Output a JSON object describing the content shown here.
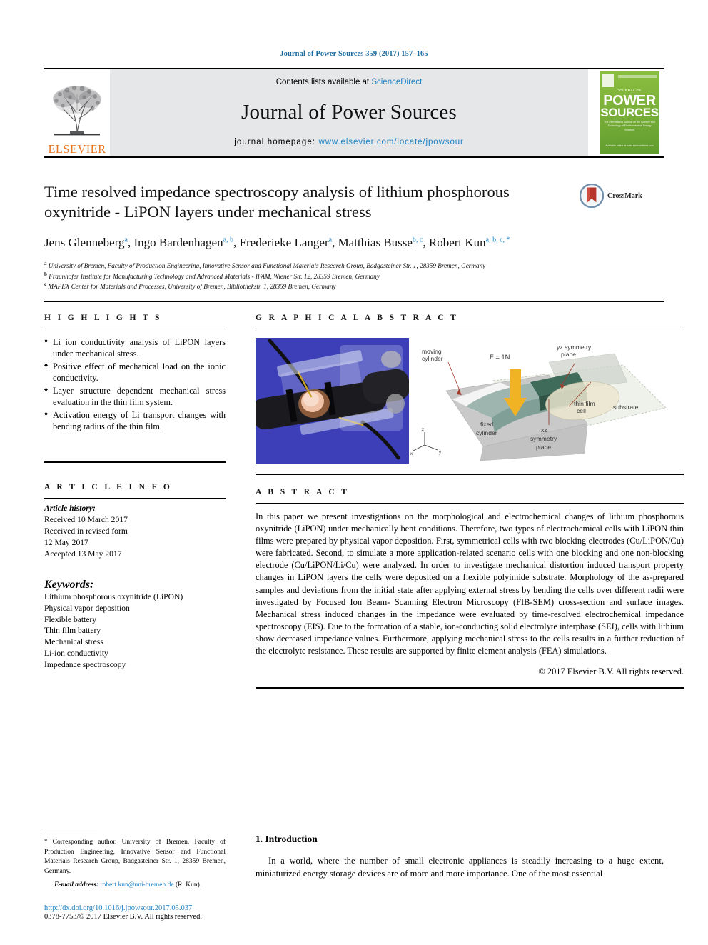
{
  "running_head": "Journal of Power Sources 359 (2017) 157–165",
  "masthead": {
    "contents_prefix": "Contents lists available at ",
    "sciencedirect": "ScienceDirect",
    "journal_title": "Journal of Power Sources",
    "homepage_label": "journal homepage:",
    "homepage_url": "www.elsevier.com/locate/jpowsour",
    "publisher": "ELSEVIER",
    "cover": {
      "kicker": "JOURNAL OF",
      "word1": "POWER",
      "word2": "SOURCES",
      "subtitle": "The International Journal on the Science and Technology of Electrochemical Energy Systems",
      "footer": "Available online at\nwww.sciencedirect.com"
    }
  },
  "article": {
    "title": "Time resolved impedance spectroscopy analysis of lithium phosphorous oxynitride - LiPON layers under mechanical stress",
    "crossmark_label": "CrossMark",
    "authors": [
      {
        "name": "Jens Glenneberg",
        "sup": "a",
        "sep": ", "
      },
      {
        "name": "Ingo Bardenhagen",
        "sup": "a, b",
        "sep": ", "
      },
      {
        "name": "Frederieke Langer",
        "sup": "a",
        "sep": ", "
      },
      {
        "name": "Matthias Busse",
        "sup": "b, c",
        "sep": ", "
      },
      {
        "name": "Robert Kun",
        "sup": "a, b, c, *",
        "sep": ""
      }
    ],
    "affiliations": [
      {
        "marker": "a",
        "text": "University of Bremen, Faculty of Production Engineering, Innovative Sensor and Functional Materials Research Group, Badgasteiner Str. 1, 28359 Bremen, Germany"
      },
      {
        "marker": "b",
        "text": "Fraunhofer Institute for Manufacturing Technology and Advanced Materials - IFAM, Wiener Str. 12, 28359 Bremen, Germany"
      },
      {
        "marker": "c",
        "text": "MAPEX Center for Materials and Processes, University of Bremen, Bibliothekstr. 1, 28359 Bremen, Germany"
      }
    ]
  },
  "highlights": {
    "heading": "H I G H L I G H T S",
    "items": [
      "Li ion conductivity analysis of LiPON layers under mechanical stress.",
      "Positive effect of mechanical load on the ionic conductivity.",
      "Layer structure dependent mechanical stress evaluation in the thin film system.",
      "Activation energy of Li transport changes with bending radius of the thin film."
    ]
  },
  "article_info": {
    "heading": "A R T I C L E  I N F O",
    "history_label": "Article history:",
    "history": [
      "Received 10 March 2017",
      "Received in revised form",
      "12 May 2017",
      "Accepted 13 May 2017"
    ],
    "keywords_label": "Keywords:",
    "keywords": [
      "Lithium phosphorous oxynitride (LiPON)",
      "Physical vapor deposition",
      "Flexible battery",
      "Thin film battery",
      "Mechanical stress",
      "Li-ion conductivity",
      "Impedance spectroscopy"
    ]
  },
  "graphical_abstract": {
    "heading": "G R A P H I C A L  A B S T R A C T",
    "diagram_labels": {
      "moving_cylinder": "moving\ncylinder",
      "force": "F = 1N",
      "yz_plane": "yz symmetry\nplane",
      "thin_film_cell": "thin film\ncell",
      "substrate": "substrate",
      "fixed_cylinder": "fixed\ncylinder",
      "xz_plane": "xz\nsymmetry\nplane",
      "axis_x": "x",
      "axis_y": "y",
      "axis_z": "z"
    }
  },
  "abstract": {
    "heading": "A B S T R A C T",
    "body": "In this paper we present investigations on the morphological and electrochemical changes of lithium phosphorous oxynitride (LiPON) under mechanically bent conditions. Therefore, two types of electrochemical cells with LiPON thin films were prepared by physical vapor deposition. First, symmetrical cells with two blocking electrodes (Cu/LiPON/Cu) were fabricated. Second, to simulate a more application-related scenario cells with one blocking and one non-blocking electrode (Cu/LiPON/Li/Cu) were analyzed. In order to investigate mechanical distortion induced transport property changes in LiPON layers the cells were deposited on a flexible polyimide substrate. Morphology of the as-prepared samples and deviations from the initial state after applying external stress by bending the cells over different radii were investigated by Focused Ion Beam- Scanning Electron Microscopy (FIB-SEM) cross-section and surface images. Mechanical stress induced changes in the impedance were evaluated by time-resolved electrochemical impedance spectroscopy (EIS). Due to the formation of a stable, ion-conducting solid electrolyte interphase (SEI), cells with lithium show decreased impedance values. Furthermore, applying mechanical stress to the cells results in a further reduction of the electrolyte resistance. These results are supported by finite element analysis (FEA) simulations.",
    "copyright": "© 2017 Elsevier B.V. All rights reserved."
  },
  "footer": {
    "corresponding_star": "*",
    "corresponding_note": "Corresponding author. University of Bremen, Faculty of Production Engineering, Innovative Sensor and Functional Materials Research Group, Badgasteiner Str. 1, 28359 Bremen, Germany.",
    "email_label": "E-mail address:",
    "email": "robert.kun@uni-bremen.de",
    "email_owner": "(R. Kun).",
    "doi": "http://dx.doi.org/10.1016/j.jpowsour.2017.05.037",
    "issn_line": "0378-7753/© 2017 Elsevier B.V. All rights reserved."
  },
  "introduction": {
    "heading": "1. Introduction",
    "paragraph": "In a world, where the number of small electronic appliances is steadily increasing to a huge extent, miniaturized energy storage devices are of more and more importance. One of the most essential"
  },
  "colors": {
    "link": "#1f83c4",
    "elsevier_orange": "#E87722",
    "masthead_bg": "#e6e7e8",
    "cover_green": "#7cb13a",
    "photo_blue": "#3c3fb8"
  }
}
